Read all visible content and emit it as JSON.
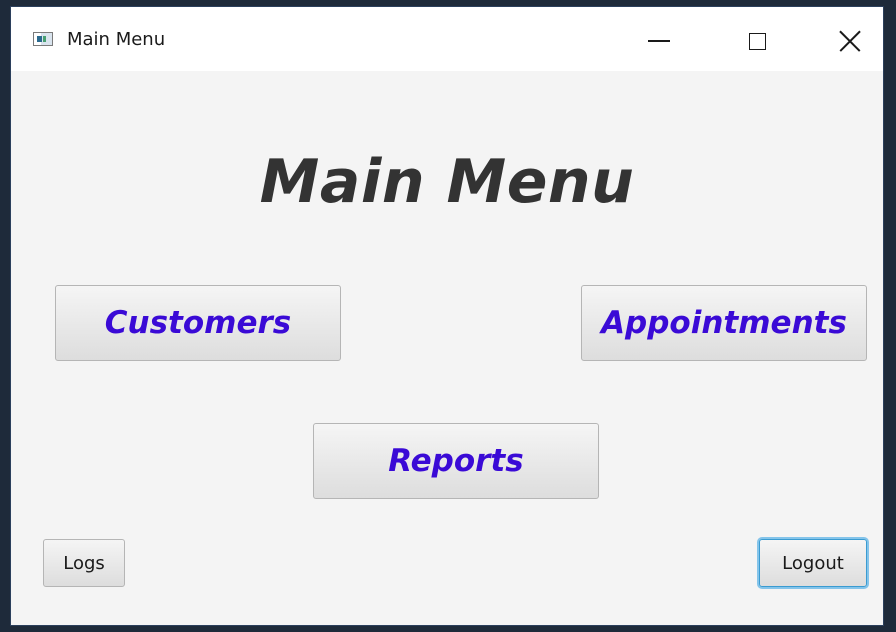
{
  "window": {
    "title": "Main Menu",
    "icon": "app-window-icon",
    "controls": [
      "minimize-icon",
      "maximize-icon",
      "close-icon"
    ]
  },
  "main": {
    "heading": "Main Menu",
    "buttons": {
      "customers": "Customers",
      "appointments": "Appointments",
      "reports": "Reports"
    }
  },
  "footer": {
    "logs": "Logs",
    "logout": "Logout"
  },
  "colors": {
    "accent_text": "#3a0ad6",
    "heading_text": "#333333",
    "background": "#f4f4f4",
    "focus_ring": "#84c4ea"
  }
}
